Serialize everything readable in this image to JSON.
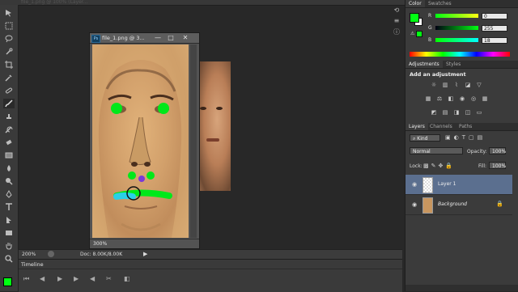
{
  "topbar": {
    "doc_tab_text": "file_1.png @ 100% (Layer..."
  },
  "document": {
    "title": "file_1.png @ 3...",
    "badge": "Ps",
    "zoom": "300%",
    "win_minimize": "—",
    "win_restore": "□",
    "win_close": "✕"
  },
  "status": {
    "zoom": "200%",
    "doc_info": "Doc: 8.00K/8.00K",
    "arrow": "▶"
  },
  "timeline": {
    "tab": "Timeline"
  },
  "color_panel": {
    "tabs": [
      "Color",
      "Swatches"
    ],
    "channels": [
      {
        "label": "R",
        "value": "0"
      },
      {
        "label": "G",
        "value": "255"
      },
      {
        "label": "B",
        "value": "18"
      }
    ],
    "foreground": "#00ff12",
    "background": "#ffffff"
  },
  "adjustments_panel": {
    "tabs": [
      "Adjustments",
      "Styles"
    ],
    "title": "Add an adjustment"
  },
  "layers_panel": {
    "tabs": [
      "Layers",
      "Channels",
      "Paths"
    ],
    "kind_label": "Kind",
    "blend_mode": "Normal",
    "opacity_label": "Opacity:",
    "opacity_value": "100%",
    "lock_label": "Lock:",
    "fill_label": "Fill:",
    "fill_value": "100%",
    "layers": [
      {
        "name": "Layer 1",
        "selected": true
      },
      {
        "name": "Background",
        "selected": false
      }
    ]
  },
  "colors": {
    "accent_green": "#00ff12",
    "selection_blue": "#5b6f8f"
  }
}
